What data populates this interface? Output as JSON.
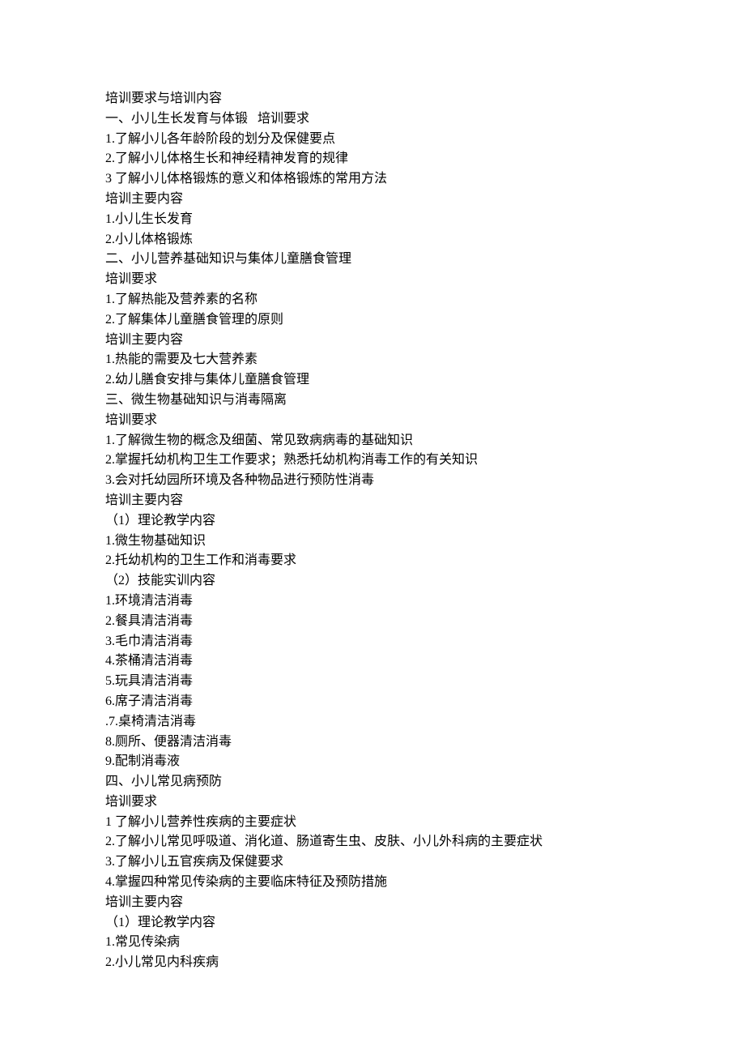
{
  "lines": [
    "培训要求与培训内容",
    "一、小儿生长发育与体锻   培训要求",
    "1.了解小儿各年龄阶段的划分及保健要点",
    "2.了解小儿体格生长和神经精神发育的规律",
    "3 了解小儿体格锻炼的意义和体格锻炼的常用方法",
    "培训主要内容",
    "1.小儿生长发育",
    "2.小儿体格锻炼",
    "二、小儿营养基础知识与集体儿童膳食管理",
    "培训要求",
    "1.了解热能及营养素的名称",
    "2.了解集体儿童膳食管理的原则",
    "培训主要内容",
    "1.热能的需要及七大营养素",
    "2.幼儿膳食安排与集体儿童膳食管理",
    "三、微生物基础知识与消毒隔离",
    "培训要求",
    "1.了解微生物的概念及细菌、常见致病病毒的基础知识",
    "2.掌握托幼机构卫生工作要求；熟悉托幼机构消毒工作的有关知识",
    "3.会对托幼园所环境及各种物品进行预防性消毒",
    "培训主要内容",
    "（1）理论教学内容",
    "1.微生物基础知识",
    "2.托幼机构的卫生工作和消毒要求",
    "（2）技能实训内容",
    "1.环境清洁消毒",
    "2.餐具清洁消毒",
    "3.毛巾清洁消毒",
    "4.茶桶清洁消毒",
    "5.玩具清洁消毒",
    "6.席子清洁消毒",
    ".7.桌椅清洁消毒",
    "8.厕所、便器清洁消毒",
    "9.配制消毒液",
    "四、小儿常见病预防",
    "培训要求",
    "1 了解小儿营养性疾病的主要症状",
    "2.了解小儿常见呼吸道、消化道、肠道寄生虫、皮肤、小儿外科病的主要症状",
    "3.了解小儿五官疾病及保健要求",
    "4.掌握四种常见传染病的主要临床特征及预防措施",
    "培训主要内容",
    "（1）理论教学内容",
    "1.常见传染病",
    "2.小儿常见内科疾病"
  ]
}
